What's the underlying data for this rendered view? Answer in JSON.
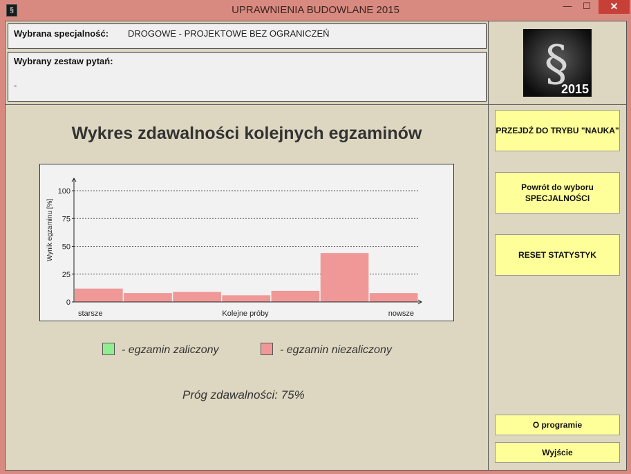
{
  "window": {
    "title": "UPRAWNIENIA BUDOWLANE 2015",
    "icon": "paragraph-icon",
    "controls": {
      "minimize": "—",
      "maximize": "☐",
      "close": "✕"
    }
  },
  "header": {
    "spec_label": "Wybrana specjalność:",
    "spec_value": "DROGOWE - PROJEKTOWE BEZ OGRANICZEŃ",
    "set_label": "Wybrany zestaw pytań:",
    "set_value": "-"
  },
  "logo": {
    "symbol": "§",
    "year": "2015"
  },
  "sidebar": {
    "btn_learn": "PRZEJDŹ DO TRYBU \"NAUKA\"",
    "btn_back": "Powrót do wyboru SPECJALNOŚCI",
    "btn_reset": "RESET STATYSTYK",
    "btn_about": "O programie",
    "btn_exit": "Wyjście"
  },
  "main": {
    "chart_title": "Wykres zdawalności kolejnych egzaminów",
    "legend_pass": "- egzamin zaliczony",
    "legend_fail": "- egzamin niezaliczony",
    "threshold": "Próg zdawalności: 75%"
  },
  "colors": {
    "pass": "#90ee90",
    "fail": "#f09898",
    "button": "#ffff99",
    "panel": "#ddd6c1"
  },
  "chart_data": {
    "type": "bar",
    "categories": [
      "",
      "",
      "",
      "",
      "",
      "",
      ""
    ],
    "values": [
      12,
      8,
      9,
      6,
      10,
      44,
      8
    ],
    "status": [
      "fail",
      "fail",
      "fail",
      "fail",
      "fail",
      "fail",
      "fail"
    ],
    "xlabel": "Kolejne próby",
    "xlabel_left": "starsze",
    "xlabel_right": "nowsze",
    "ylabel": "Wynik egzaminu [%]",
    "ylim": [
      0,
      100
    ],
    "yticks": [
      0,
      25,
      50,
      75,
      100
    ],
    "grid": true
  }
}
